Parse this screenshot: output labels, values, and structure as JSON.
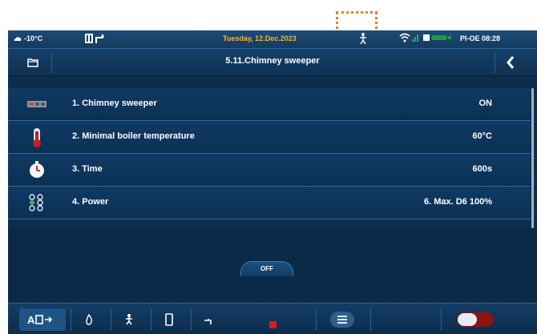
{
  "statusbar": {
    "outside_temp": "-10°C",
    "date": "Tuesday, 12.Dec.2023",
    "device_id": "PI-OE 08:28"
  },
  "header": {
    "title": "5.11.Chimney sweeper"
  },
  "menu": {
    "items": [
      {
        "label": "1. Chimney sweeper",
        "value": "ON",
        "icon": "chimney-sweeper-icon"
      },
      {
        "label": "2. Minimal boiler temperature",
        "value": "60°C",
        "icon": "thermometer-icon"
      },
      {
        "label": "3. Time",
        "value": "600s",
        "icon": "timer-icon"
      },
      {
        "label": "4. Power",
        "value": "6. Max. D6 100%",
        "icon": "power-levels-icon"
      }
    ]
  },
  "bottombar": {
    "off_label": "OFF"
  },
  "colors": {
    "screen_bg": "#0e2d4c",
    "accent": "#2a6496",
    "highlight": "#f07d1f",
    "off_red": "#d81e1e"
  }
}
